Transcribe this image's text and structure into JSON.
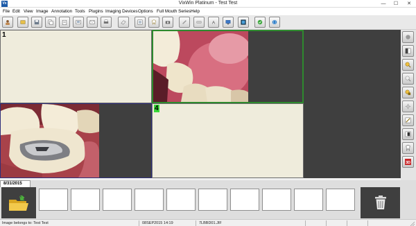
{
  "window": {
    "title": "VixWin Platinum - Test Test",
    "logo_text": "Vx",
    "controls": {
      "minimize": "—",
      "maximize": "☐",
      "close": "✕"
    }
  },
  "menu": [
    "File",
    "Edit",
    "View",
    "Image",
    "Annotation",
    "Tools",
    "Plugins",
    "Imaging Devices",
    "Options",
    "Full Mouth Series",
    "Help"
  ],
  "toolbar": {
    "buttons": [
      "patient-icon",
      "open-icon",
      "save-icon",
      "copy-icon",
      "paste-icon",
      "email-icon",
      "print-icon",
      "eraser-icon",
      "pencil-icon",
      "ruler-icon",
      "text-annotation-icon",
      "monitor-icon",
      "layout-icon",
      "check-icon",
      "globe-icon"
    ]
  },
  "panels": [
    {
      "number": "1",
      "state": "empty"
    },
    {
      "number": "",
      "state": "image",
      "image": "upper-teeth-gum-photo"
    },
    {
      "number": "",
      "state": "image",
      "image": "molar-amalgam-photo"
    },
    {
      "number": "4",
      "state": "empty"
    }
  ],
  "right_toolbar": {
    "buttons": [
      "brightness-icon",
      "contrast-icon",
      "zoom-in-icon",
      "zoom-out-icon",
      "pan-icon",
      "sharpen-icon",
      "rotate-icon",
      "invert-icon",
      "tooth-icon",
      "3d-icon",
      "flip-icon",
      "compare-icon",
      "settings-icon"
    ],
    "label_3d": "3D"
  },
  "filmstrip": {
    "date": "8/31/2015",
    "thumbnail_count": 10,
    "folder_icon": "folder-open-icon",
    "trash_icon": "trash-icon"
  },
  "status": {
    "belongs_to": "Image belongs to: Test Test",
    "datetime": "08SEP2015 14:19",
    "filename": "7LBBD01.JIF"
  },
  "colors": {
    "empty_panel": "#efecdc",
    "selected_border": "#2e8a2e",
    "panel_number_highlight": "#39d739",
    "dark_area": "#3f3f3f",
    "toolbar_bg": "#e9e9e9"
  }
}
